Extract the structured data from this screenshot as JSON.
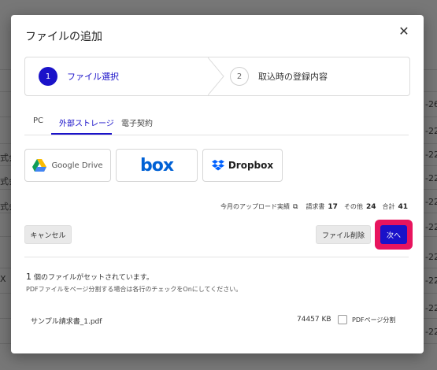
{
  "modal": {
    "title": "ファイルの追加",
    "close_icon": "✕"
  },
  "stepper": {
    "steps": [
      {
        "num": "1",
        "label": "ファイル選択"
      },
      {
        "num": "2",
        "label": "取込時の登録内容"
      }
    ]
  },
  "tabs": [
    "PC",
    "外部ストレージ",
    "電子契約"
  ],
  "providers": {
    "google_drive": "Google Drive",
    "box": "box",
    "dropbox": "Dropbox"
  },
  "stats": {
    "label": "今月のアップロード実績",
    "invoice_label": "請求書",
    "invoice_count": "17",
    "other_label": "その他",
    "other_count": "24",
    "total_label": "合計",
    "total_count": "41"
  },
  "buttons": {
    "cancel": "キャンセル",
    "delete": "ファイル削除",
    "next": "次へ"
  },
  "summary": {
    "count": "1",
    "count_text": "個のファイルがセットされています。",
    "note": "PDFファイルをページ分割する場合は各行のチェックをOnにしてください。"
  },
  "file": {
    "name": "サンプル請求書_1.pdf",
    "size": "74457 KB",
    "split_label": "PDFページ分割"
  },
  "background": {
    "cells": [
      "-26",
      "-22",
      "-22",
      "-22",
      "-22",
      "-22",
      "-22",
      "-22",
      "-22",
      "-22",
      "式会",
      "式会",
      "式会",
      "X"
    ]
  },
  "colors": {
    "accent": "#1a12c9",
    "highlight": "#e8145e",
    "box_blue": "#0061d5"
  }
}
